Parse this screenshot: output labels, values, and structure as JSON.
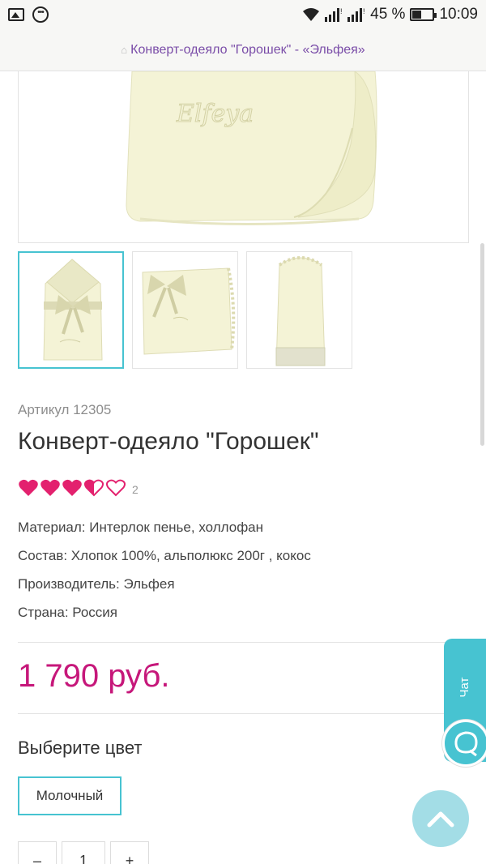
{
  "status_bar": {
    "battery_percent": "45 %",
    "time": "10:09"
  },
  "url_bar": {
    "title": "Конверт-одеяло \"Горошек\" - «Эльфея»"
  },
  "product": {
    "main_image_brand": "Elfeya",
    "thumbnail_count": 3,
    "active_thumbnail": 1,
    "article": "Артикул 12305",
    "title": "Конверт-одеяло \"Горошек\"",
    "rating": {
      "filled_hearts": 3,
      "total_hearts": 5,
      "count": "2"
    },
    "properties": [
      "Материал: Интерлок пенье, холлофан",
      "Состав: Хлопок 100%, альполюкс 200г , кокос",
      "Производитель: Эльфея",
      "Страна: Россия"
    ],
    "price": "1 790 руб.",
    "color_section_title": "Выберите цвет",
    "color_option": "Молочный",
    "quantity": {
      "minus": "–",
      "value": "1",
      "plus": "+"
    }
  },
  "chat_widget": {
    "label": "Чат"
  },
  "colors": {
    "accent": "#47c3d1",
    "price": "#c6177a",
    "heart": "#e3216e",
    "url_text": "#7a4da8",
    "product_cream": "#f4f3d6"
  }
}
